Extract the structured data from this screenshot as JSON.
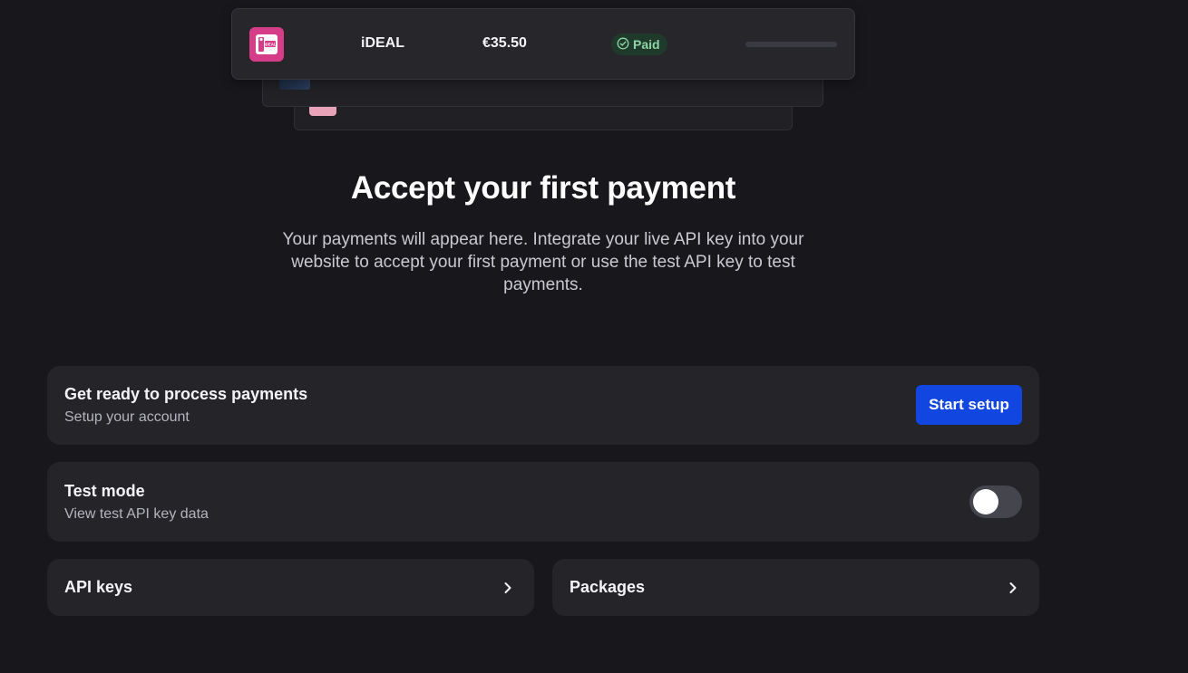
{
  "illustration": {
    "payment_method": "iDEAL",
    "amount": "€35.50",
    "status": "Paid",
    "logo_text": "iDEAL",
    "icons": [
      "ideal-logo-icon",
      "check-circle-icon"
    ],
    "colors": {
      "ideal_pink": "#d63d88",
      "paid_bg": "#1f3a2a",
      "paid_text": "#8fd5a6"
    }
  },
  "hero": {
    "title": "Accept your first payment",
    "description": "Your payments will appear here. Integrate your live API key into your website to accept your first payment or use the test API key to test payments."
  },
  "setup": {
    "title": "Get ready to process payments",
    "subtitle": "Setup your account",
    "button_label": "Start setup",
    "button_color": "#1146e0"
  },
  "test_mode": {
    "title": "Test mode",
    "subtitle": "View test API key data",
    "enabled": false
  },
  "links": [
    {
      "label": "API keys",
      "icon": "chevron-right-icon"
    },
    {
      "label": "Packages",
      "icon": "chevron-right-icon"
    }
  ]
}
